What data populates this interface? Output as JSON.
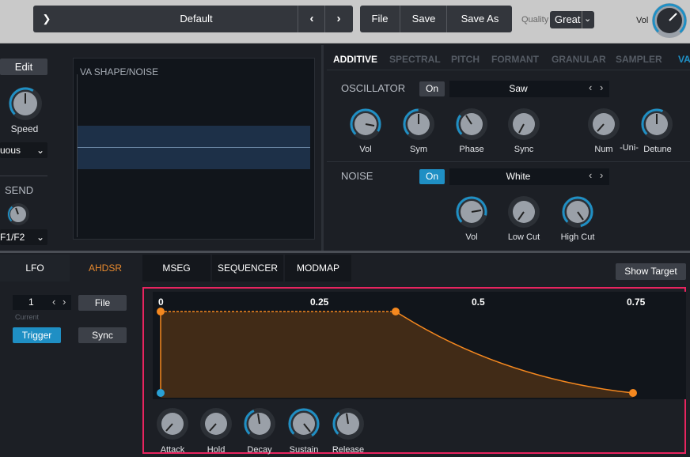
{
  "topbar": {
    "preset_name": "Default",
    "file": "File",
    "save": "Save",
    "save_as": "Save As",
    "quality_label": "Quality",
    "quality_value": "Great",
    "vol_label": "Vol"
  },
  "left": {
    "edit": "Edit",
    "speed": "Speed",
    "mode": "uous",
    "send": "SEND",
    "route": "F1/F2"
  },
  "shape_panel": {
    "title": "VA SHAPE/NOISE"
  },
  "source_tabs": [
    "ADDITIVE",
    "SPECTRAL",
    "PITCH",
    "FORMANT",
    "GRANULAR",
    "SAMPLER",
    "VA"
  ],
  "oscillator": {
    "label": "OSCILLATOR",
    "on": "On",
    "wave": "Saw",
    "knobs": {
      "vol": "Vol",
      "sym": "Sym",
      "phase": "Phase",
      "sync": "Sync",
      "num": "Num",
      "uni": "-Uni-",
      "detune": "Detune"
    }
  },
  "noise": {
    "label": "NOISE",
    "on": "On",
    "type": "White",
    "knobs": {
      "vol": "Vol",
      "low_cut": "Low Cut",
      "high_cut": "High Cut"
    }
  },
  "mod_tabs": [
    "LFO",
    "AHDSR",
    "MSEG",
    "SEQUENCER",
    "MODMAP"
  ],
  "show_target": "Show Target",
  "env": {
    "index": "1",
    "current": "Current",
    "file": "File",
    "trigger": "Trigger",
    "sync": "Sync",
    "ruler": [
      "0",
      "0.25",
      "0.5",
      "0.75"
    ],
    "knobs": [
      "Attack",
      "Hold",
      "Decay",
      "Sustain",
      "Release"
    ]
  },
  "colors": {
    "accent": "#1f8fc4",
    "envelope": "#f5881f",
    "highlight_border": "#e8245f",
    "active_tab": "#e88a2e"
  }
}
